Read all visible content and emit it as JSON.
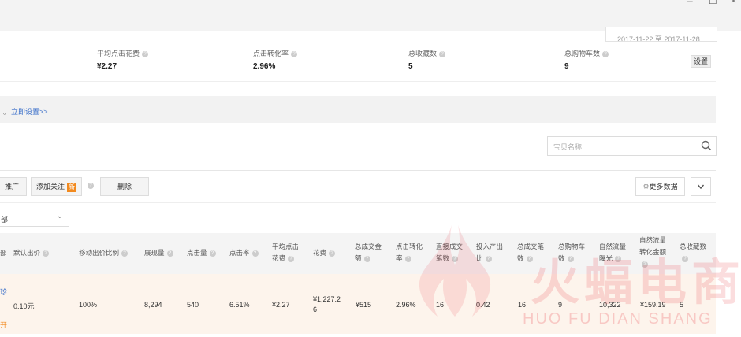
{
  "window": {
    "minimize_icon": "–",
    "maximize_icon": "☐",
    "close_icon": "×"
  },
  "date_range": "2017-11-22 至 2017-11-28",
  "metrics": [
    {
      "label": "平均点击花费",
      "value": "¥2.27"
    },
    {
      "label": "点击转化率",
      "value": "2.96%"
    },
    {
      "label": "总收藏数",
      "value": "5"
    },
    {
      "label": "总购物车数",
      "value": "9"
    }
  ],
  "settings_button": "设置",
  "notice": {
    "prefix": "。",
    "link": "立即设置>>"
  },
  "search": {
    "placeholder": "宝贝名称"
  },
  "toolbar": {
    "promote_fragment": "推广",
    "add_follow": "添加关注",
    "new_badge": "新",
    "delete": "删除",
    "more_data": "更多数据"
  },
  "filter": {
    "value": "部"
  },
  "table": {
    "headers": {
      "col0": "部",
      "default_bid": "默认出价",
      "mobile_ratio": "移动出价比例",
      "impressions": "展现量",
      "clicks": "点击量",
      "ctr": "点击率",
      "avg_cpc_1": "平均点击",
      "avg_cpc_2": "花费",
      "cost": "花费",
      "gmv_1": "总成交金",
      "gmv_2": "额",
      "cvr_1": "点击转化",
      "cvr_2": "率",
      "direct_1": "直接成交",
      "direct_2": "笔数",
      "roi_1": "投入产出",
      "roi_2": "比",
      "orders_1": "总成交笔",
      "orders_2": "数",
      "cart_1": "总购物车",
      "cart_2": "数",
      "natural_1": "自然流量",
      "natural_2": "曝光",
      "natural_amt_1": "自然流量",
      "natural_amt_2": "转化金额",
      "fav": "总收藏数"
    },
    "row": {
      "col0_top": "珍",
      "col0_bottom": "开",
      "default_bid": "0.10元",
      "mobile_ratio": "100%",
      "impressions": "8,294",
      "clicks": "540",
      "ctr": "6.51%",
      "avg_cpc": "¥2.27",
      "cost_1": "¥1,227.2",
      "cost_2": "6",
      "gmv": "¥515",
      "cvr": "2.96%",
      "direct": "16",
      "roi": "0.42",
      "orders": "16",
      "cart": "9",
      "natural": "10,322",
      "natural_amt": "¥159.19",
      "fav": "5"
    }
  },
  "watermark": {
    "cn": "火蝠电商",
    "en": "HUO FU DIAN SHANG"
  },
  "colors": {
    "link": "#3a6fc9",
    "badge": "#f28a1f",
    "watermark": "#e8303a"
  }
}
